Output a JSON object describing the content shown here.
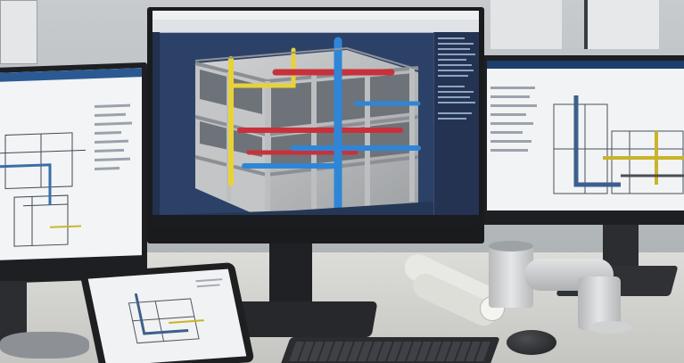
{
  "scene": {
    "description_icons": {
      "center_monitor": "bim-3d-building-model",
      "left_monitor": "floor-plan-drawing",
      "right_monitor": "piping-floor-plan",
      "tablet": "mini-floor-plan",
      "desk_items": [
        "keyboard-icon",
        "mouse-icon",
        "rolled-blueprints-icon",
        "pipe-elbow-model-icon"
      ]
    },
    "colors": {
      "viewport_bg": "#2c4168",
      "duct_red": "#c8313a",
      "duct_blue": "#2f86d6",
      "duct_yellow": "#e8d23a",
      "concrete": "#b9bbbd",
      "desk": "#d6d6d2",
      "wall": "#cfd2d4"
    }
  }
}
